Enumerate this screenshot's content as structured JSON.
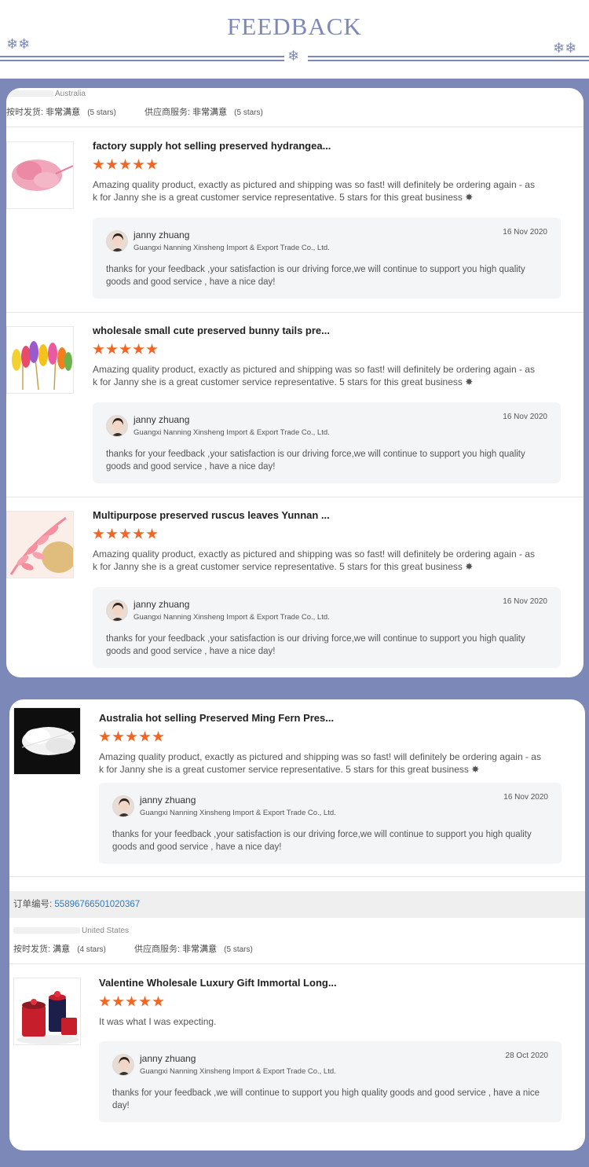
{
  "header": {
    "title": "FEEDBACK"
  },
  "colors": {
    "accent": "#7c89b8",
    "star": "#f26522",
    "link": "#2f7bbf"
  },
  "card1": {
    "buyer_country": "Australia",
    "ratings": {
      "ship_label": "按时发货:",
      "ship_value": "非常满意",
      "ship_stars": "(5 stars)",
      "service_label": "供应商服务:",
      "service_value": "非常满意",
      "service_stars": "(5 stars)"
    },
    "reviews": [
      {
        "title": "factory supply hot selling preserved hydrangea...",
        "rating": 5,
        "text": "Amazing quality product, exactly as pictured and shipping was so fast! will definitely be ordering again - as k for Janny she is a great customer service representative. 5 stars for this great business ✸",
        "reply": {
          "name": "janny zhuang",
          "company": "Guangxi Nanning Xinsheng Import & Export Trade Co., Ltd.",
          "date": "16 Nov 2020",
          "text": "thanks for your feedback ,your satisfaction is our driving force,we will continue to support you high quality goods and good service , have a nice day!"
        }
      },
      {
        "title": "wholesale small cute preserved bunny tails pre...",
        "rating": 5,
        "text": "Amazing quality product, exactly as pictured and shipping was so fast! will definitely be ordering again - as k for Janny she is a great customer service representative. 5 stars for this great business ✸",
        "reply": {
          "name": "janny zhuang",
          "company": "Guangxi Nanning Xinsheng Import & Export Trade Co., Ltd.",
          "date": "16 Nov 2020",
          "text": "thanks for your feedback ,your satisfaction is our driving force,we will continue to support you high quality goods and good service , have a nice day!"
        }
      },
      {
        "title": "Multipurpose preserved ruscus leaves Yunnan ...",
        "rating": 5,
        "text": "Amazing quality product, exactly as pictured and shipping was so fast! will definitely be ordering again - as k for Janny she is a great customer service representative. 5 stars for this great business ✸",
        "reply": {
          "name": "janny zhuang",
          "company": "Guangxi Nanning Xinsheng Import & Export Trade Co., Ltd.",
          "date": "16 Nov 2020",
          "text": "thanks for your feedback ,your satisfaction is our driving force,we will continue to support you high quality goods and good service , have a nice day!"
        }
      }
    ]
  },
  "card2": {
    "reviews": [
      {
        "title": "Australia hot selling Preserved Ming Fern Pres...",
        "rating": 5,
        "text": "Amazing quality product, exactly as pictured and shipping was so fast! will definitely be ordering again - as k for Janny she is a great customer service representative. 5 stars for this great business ✸",
        "reply": {
          "name": "janny zhuang",
          "company": "Guangxi Nanning Xinsheng Import & Export Trade Co., Ltd.",
          "date": "16 Nov 2020",
          "text": "thanks for your feedback ,your satisfaction is our driving force,we will continue to support you high quality goods and good service , have a nice day!"
        }
      },
      {
        "title": "Valentine Wholesale Luxury Gift Immortal Long...",
        "rating": 5,
        "text": "It was what I was expecting.",
        "reply": {
          "name": "janny zhuang",
          "company": "Guangxi Nanning Xinsheng Import & Export Trade Co., Ltd.",
          "date": "28 Oct 2020",
          "text": "thanks for  your feedback ,we will continue to support you high quality goods and good service , have a nice day!"
        }
      }
    ],
    "order": {
      "label": "订单编号:",
      "number": "55896766501020367"
    },
    "buyer_country": "United States",
    "ratings": {
      "ship_label": "按时发货:",
      "ship_value": "满意",
      "ship_stars": "(4 stars)",
      "service_label": "供应商服务:",
      "service_value": "非常满意",
      "service_stars": "(5 stars)"
    }
  }
}
